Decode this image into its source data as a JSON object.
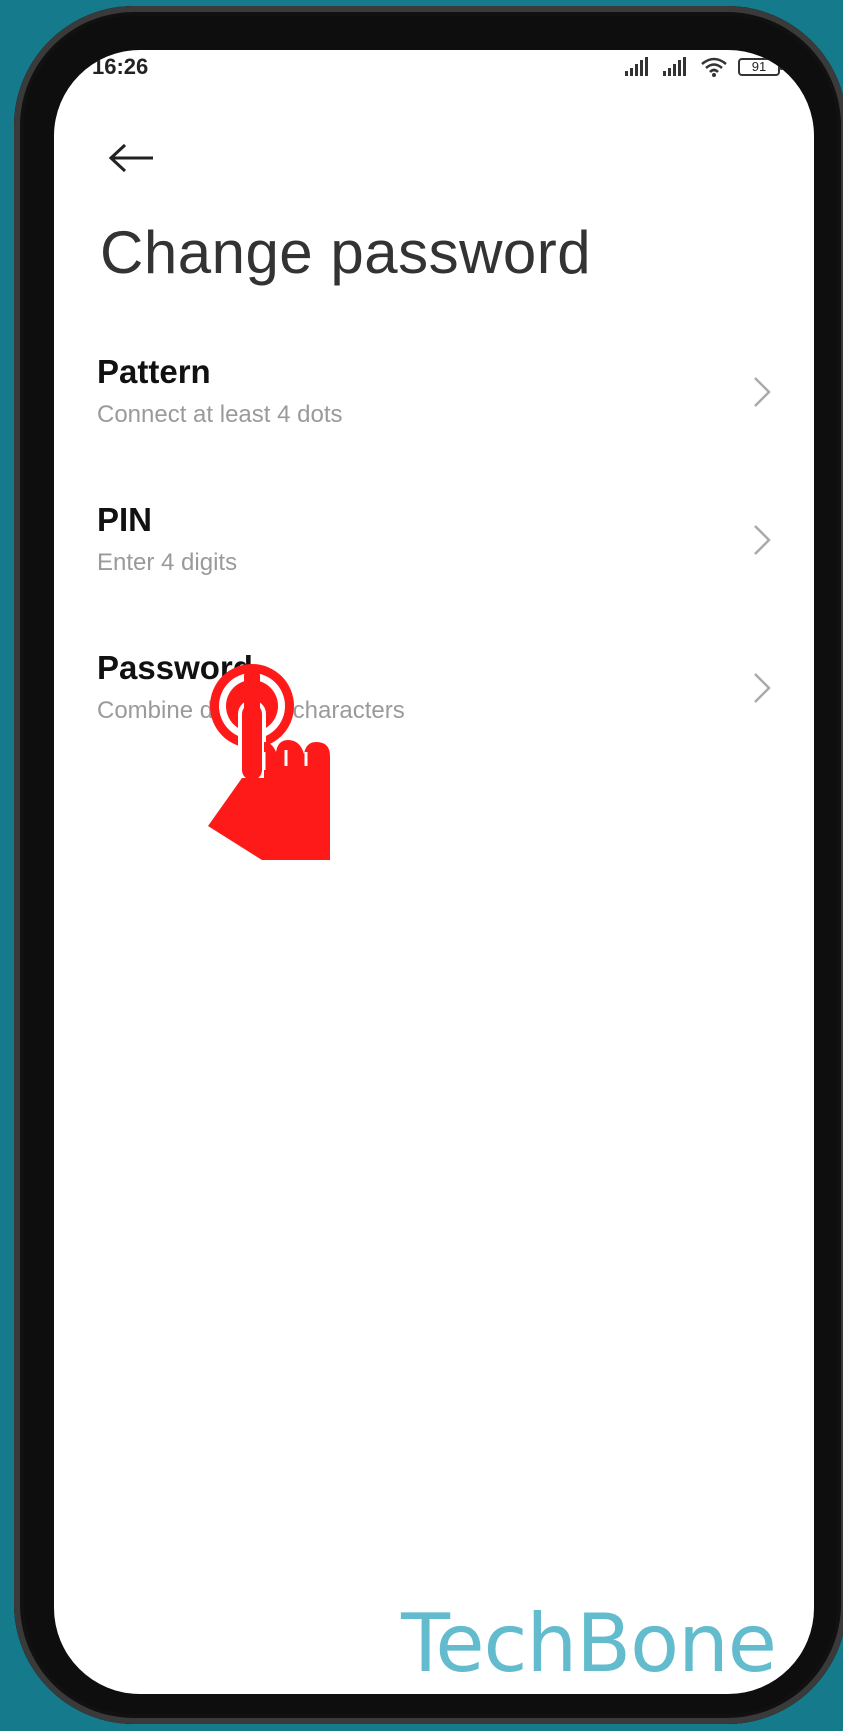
{
  "status_bar": {
    "time": "16:26",
    "battery": "91",
    "icons": [
      "signal-icon",
      "signal-icon",
      "wifi-icon",
      "battery-icon"
    ]
  },
  "header": {
    "back_icon": "back-arrow-icon",
    "title": "Change password"
  },
  "options": [
    {
      "title": "Pattern",
      "subtitle": "Connect at least 4 dots",
      "icon": "chevron-right-icon"
    },
    {
      "title": "PIN",
      "subtitle": "Enter 4 digits",
      "icon": "chevron-right-icon"
    },
    {
      "title": "Password",
      "subtitle": "Combine different characters",
      "icon": "chevron-right-icon"
    }
  ],
  "overlay": {
    "icon": "tap-hand-icon",
    "color": "#ff1a1a"
  },
  "watermark": "TechBone",
  "colors": {
    "background": "#157a8c",
    "watermark": "#62bccd",
    "subtitle": "#9a9a9a"
  }
}
